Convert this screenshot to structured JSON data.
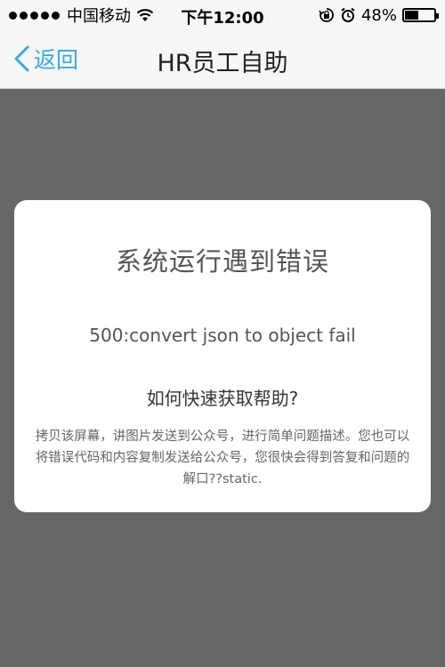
{
  "status_bar": {
    "carrier": "中国移动",
    "time": "下午12:00",
    "battery": "48%",
    "battery_level": 0.48
  },
  "nav": {
    "back_label": "返回",
    "title": "HR员工自助"
  },
  "error_card": {
    "title": "系统运行遇到错误",
    "message": "500:convert json to object fail",
    "help_heading": "如何快速获取帮助?",
    "help_text": "拷贝该屏幕，讲图片发送到公众号，进行简单问题描述。您也可以将错误代码和内容复制发送给公众号，您很快会得到答复和问题的解口??static."
  },
  "colors": {
    "accent": "#3aa7e6",
    "overlay": "#666666",
    "card": "#ffffff"
  }
}
